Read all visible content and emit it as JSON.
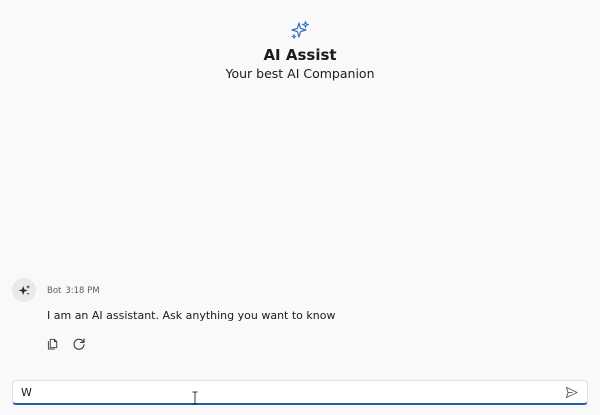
{
  "banner": {
    "icon": "sparkle-icon",
    "title": "AI Assist",
    "subtitle": "Your best AI Companion"
  },
  "message": {
    "avatar_icon": "sparkle-icon",
    "author": "Bot",
    "time": "3:18 PM",
    "text": "I am an AI assistant. Ask anything you want to know",
    "actions": [
      {
        "icon": "copy-icon"
      },
      {
        "icon": "regenerate-icon"
      }
    ]
  },
  "composer": {
    "value": "W",
    "send_icon": "send-icon"
  },
  "colors": {
    "accent": "#1f5fa8",
    "background": "#f9f9fb",
    "avatar_bg": "#e9e9ec",
    "icon_blue": "#2f6fb8"
  }
}
